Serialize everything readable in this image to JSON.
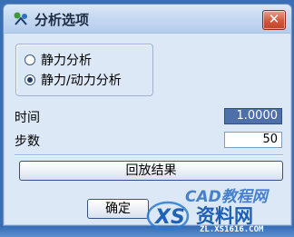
{
  "window": {
    "title": "分析选项",
    "close_label": "✕"
  },
  "radio_options": [
    {
      "label": "静力分析",
      "checked": false
    },
    {
      "label": "静力/动力分析",
      "checked": true
    }
  ],
  "fields": {
    "time": {
      "label": "时间",
      "value": "1.0000"
    },
    "steps": {
      "label": "步数",
      "value": "50"
    }
  },
  "buttons": {
    "playback": "回放结果",
    "ok": "确定"
  },
  "watermark": {
    "cad": "CAD教程网",
    "site_cn": "资料网",
    "site_url": "ZL.XS1616.COM"
  }
}
